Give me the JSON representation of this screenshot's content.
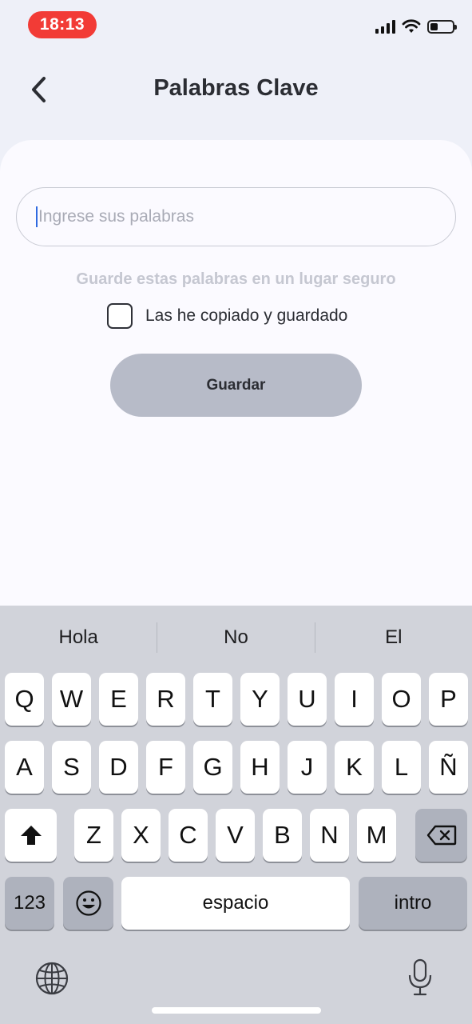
{
  "status_bar": {
    "time": "18:13",
    "icons": [
      "cellular-signal-icon",
      "wifi-icon",
      "battery-icon"
    ]
  },
  "header": {
    "back_icon": "chevron-left-icon",
    "title": "Palabras Clave"
  },
  "form": {
    "input_placeholder": "Ingrese sus palabras",
    "input_value": "",
    "hint": "Guarde estas palabras en un lugar seguro",
    "checkbox_label": "Las he copiado y guardado",
    "checkbox_checked": false,
    "save_label": "Guardar"
  },
  "keyboard": {
    "suggestions": [
      "Hola",
      "No",
      "El"
    ],
    "row1": [
      "Q",
      "W",
      "E",
      "R",
      "T",
      "Y",
      "U",
      "I",
      "O",
      "P"
    ],
    "row2": [
      "A",
      "S",
      "D",
      "F",
      "G",
      "H",
      "J",
      "K",
      "L",
      "Ñ"
    ],
    "row3": [
      "Z",
      "X",
      "C",
      "V",
      "B",
      "N",
      "M"
    ],
    "numbers_label": "123",
    "space_label": "espacio",
    "return_label": "intro",
    "icons": [
      "shift-icon",
      "backspace-icon",
      "emoji-icon",
      "globe-icon",
      "microphone-icon"
    ]
  },
  "colors": {
    "time_pill": "#f23b36",
    "caret": "#2f6ae0",
    "save_button": "#b7bbc8",
    "keyboard_bg": "#d1d3da"
  }
}
